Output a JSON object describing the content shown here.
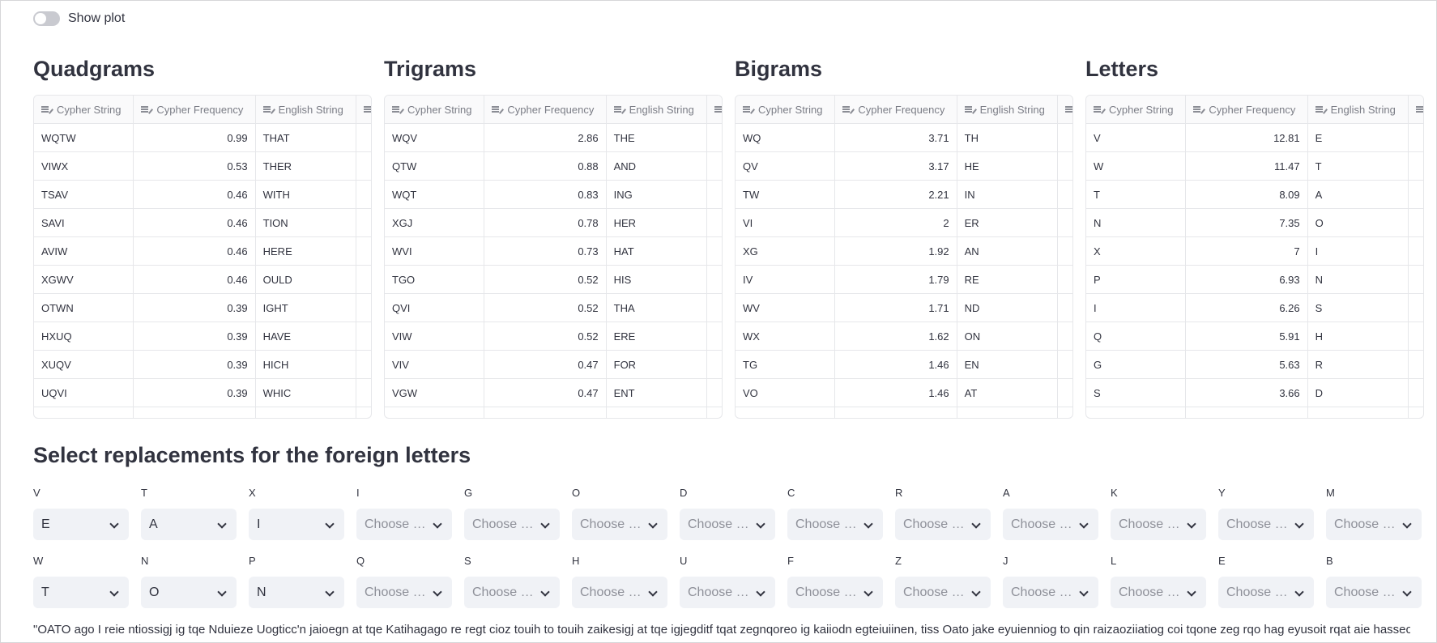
{
  "toggle": {
    "label": "Show plot",
    "on": false
  },
  "columns": [
    "Cypher String",
    "Cypher Frequency",
    "English String"
  ],
  "tables": [
    {
      "title": "Quadgrams",
      "rows": [
        [
          "WQTW",
          "0.99",
          "THAT"
        ],
        [
          "VIWX",
          "0.53",
          "THER"
        ],
        [
          "TSAV",
          "0.46",
          "WITH"
        ],
        [
          "SAVI",
          "0.46",
          "TION"
        ],
        [
          "AVIW",
          "0.46",
          "HERE"
        ],
        [
          "XGWV",
          "0.46",
          "OULD"
        ],
        [
          "OTWN",
          "0.39",
          "IGHT"
        ],
        [
          "HXUQ",
          "0.39",
          "HAVE"
        ],
        [
          "XUQV",
          "0.39",
          "HICH"
        ],
        [
          "UQVI",
          "0.39",
          "WHIC"
        ]
      ]
    },
    {
      "title": "Trigrams",
      "rows": [
        [
          "WQV",
          "2.86",
          "THE"
        ],
        [
          "QTW",
          "0.88",
          "AND"
        ],
        [
          "WQT",
          "0.83",
          "ING"
        ],
        [
          "XGJ",
          "0.78",
          "HER"
        ],
        [
          "WVI",
          "0.73",
          "HAT"
        ],
        [
          "TGO",
          "0.52",
          "HIS"
        ],
        [
          "QVI",
          "0.52",
          "THA"
        ],
        [
          "VIW",
          "0.52",
          "ERE"
        ],
        [
          "VIV",
          "0.47",
          "FOR"
        ],
        [
          "VGW",
          "0.47",
          "ENT"
        ]
      ]
    },
    {
      "title": "Bigrams",
      "rows": [
        [
          "WQ",
          "3.71",
          "TH"
        ],
        [
          "QV",
          "3.17",
          "HE"
        ],
        [
          "TW",
          "2.21",
          "IN"
        ],
        [
          "VI",
          "2",
          "ER"
        ],
        [
          "XG",
          "1.92",
          "AN"
        ],
        [
          "IV",
          "1.79",
          "RE"
        ],
        [
          "WV",
          "1.71",
          "ND"
        ],
        [
          "WX",
          "1.62",
          "ON"
        ],
        [
          "TG",
          "1.46",
          "EN"
        ],
        [
          "VO",
          "1.46",
          "AT"
        ]
      ]
    },
    {
      "title": "Letters",
      "rows": [
        [
          "V",
          "12.81",
          "E"
        ],
        [
          "W",
          "11.47",
          "T"
        ],
        [
          "T",
          "8.09",
          "A"
        ],
        [
          "N",
          "7.35",
          "O"
        ],
        [
          "X",
          "7",
          "I"
        ],
        [
          "P",
          "6.93",
          "N"
        ],
        [
          "I",
          "6.26",
          "S"
        ],
        [
          "Q",
          "5.91",
          "H"
        ],
        [
          "G",
          "5.63",
          "R"
        ],
        [
          "S",
          "3.66",
          "D"
        ]
      ]
    }
  ],
  "replacements": {
    "title": "Select replacements for the foreign letters",
    "placeholder": "Choose an option",
    "row1": [
      {
        "letter": "V",
        "value": "E"
      },
      {
        "letter": "T",
        "value": "A"
      },
      {
        "letter": "X",
        "value": "I"
      },
      {
        "letter": "I",
        "value": ""
      },
      {
        "letter": "G",
        "value": ""
      },
      {
        "letter": "O",
        "value": ""
      },
      {
        "letter": "D",
        "value": ""
      },
      {
        "letter": "C",
        "value": ""
      },
      {
        "letter": "R",
        "value": ""
      },
      {
        "letter": "A",
        "value": ""
      },
      {
        "letter": "K",
        "value": ""
      },
      {
        "letter": "Y",
        "value": ""
      },
      {
        "letter": "M",
        "value": ""
      }
    ],
    "row2": [
      {
        "letter": "W",
        "value": "T"
      },
      {
        "letter": "N",
        "value": "O"
      },
      {
        "letter": "P",
        "value": "N"
      },
      {
        "letter": "Q",
        "value": ""
      },
      {
        "letter": "S",
        "value": ""
      },
      {
        "letter": "H",
        "value": ""
      },
      {
        "letter": "U",
        "value": ""
      },
      {
        "letter": "F",
        "value": ""
      },
      {
        "letter": "Z",
        "value": ""
      },
      {
        "letter": "J",
        "value": ""
      },
      {
        "letter": "L",
        "value": ""
      },
      {
        "letter": "E",
        "value": ""
      },
      {
        "letter": "B",
        "value": ""
      }
    ]
  },
  "cipher_text": "\"OATO ago I reie ntiossigj ig tqe Nduieze Uogticc'n jaioegn at tqe Katihagago re regt cioz touih to touih zaikesigj at tqe igjegditf tqat zegnqoreo ig kaiiodn egteiuiinen, tiss Oato jake eyuienniog to qin raizaoziiatiog coi tqone zeg rqo hag eyusoit rqat aie hasseo"
}
